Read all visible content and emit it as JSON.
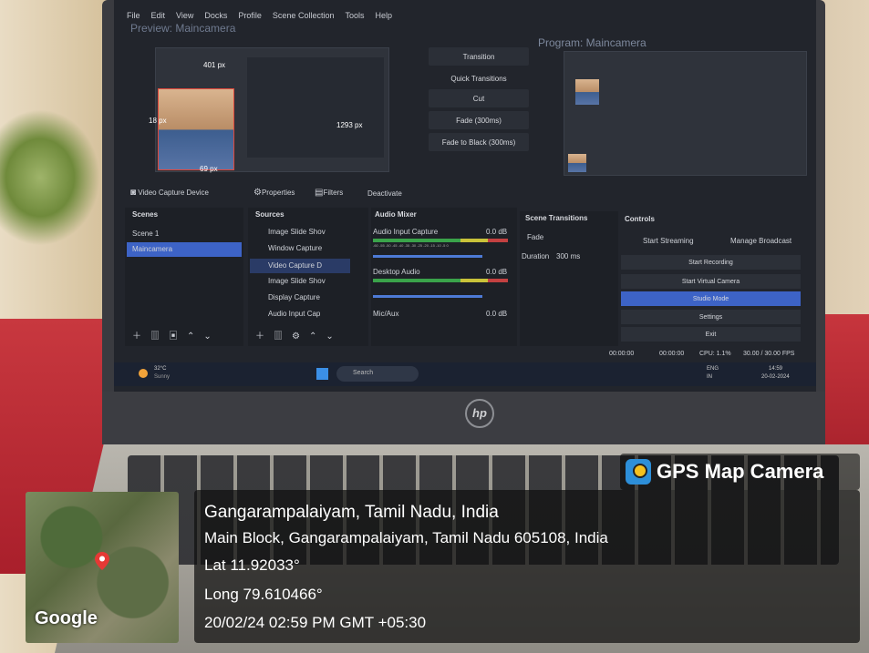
{
  "obs": {
    "menu": [
      "File",
      "Edit",
      "View",
      "Docks",
      "Profile",
      "Scene Collection",
      "Tools",
      "Help"
    ],
    "preview_title": "Preview: Maincamera",
    "program_title": "Program: Maincamera",
    "measurements": {
      "top": "401 px",
      "left": "18 px",
      "right": "1293 px",
      "bottom": "69 px"
    },
    "transition_buttons": [
      "Transition",
      "Quick Transitions",
      "Cut",
      "Fade (300ms)",
      "Fade to Black (300ms)"
    ],
    "source_toolbar": {
      "label": "Video Capture Device",
      "properties": "Properties",
      "filters": "Filters",
      "deactivate": "Deactivate"
    },
    "scenes": {
      "header": "Scenes",
      "items": [
        "Scene 1",
        "Maincamera"
      ],
      "selected": "Maincamera"
    },
    "sources": {
      "header": "Sources",
      "items": [
        "Image Slide Shov",
        "Window Capture",
        "Video Capture D",
        "Image Slide Shov",
        "Display Capture",
        "Audio Input Cap"
      ],
      "selected_index": 2
    },
    "audio_mixer": {
      "header": "Audio Mixer",
      "channels": [
        {
          "name": "Audio Input Capture",
          "level": "0.0 dB"
        },
        {
          "name": "Desktop Audio",
          "level": "0.0 dB"
        },
        {
          "name": "Mic/Aux",
          "level": "0.0 dB"
        }
      ],
      "scale": "-60 -55 -50 -45 -40 -35 -30 -25 -20 -15 -10 -5 0"
    },
    "scene_transitions": {
      "header": "Scene Transitions",
      "type": "Fade",
      "duration_label": "Duration",
      "duration_value": "300 ms"
    },
    "controls": {
      "header": "Controls",
      "start_streaming": "Start Streaming",
      "manage_broadcast": "Manage Broadcast",
      "start_recording": "Start Recording",
      "start_virtual_camera": "Start Virtual Camera",
      "studio_mode": "Studio Mode",
      "settings": "Settings",
      "exit": "Exit"
    },
    "status": {
      "stream_time": "00:00:00",
      "rec_time": "00:00:00",
      "cpu": "CPU: 1.1%",
      "fps": "30.00 / 30.00 FPS"
    }
  },
  "taskbar": {
    "weather_temp": "32°C",
    "weather_desc": "Sunny",
    "search_placeholder": "Search",
    "lang": "ENG",
    "region": "IN",
    "time": "14:59",
    "date": "20-02-2024"
  },
  "laptop_brand": "hp",
  "gps": {
    "badge": "GPS Map Camera",
    "place": "Gangarampalaiyam, Tamil Nadu, India",
    "address": "Main Block, Gangarampalaiyam, Tamil Nadu 605108, India",
    "lat": "Lat 11.92033°",
    "long": "Long 79.610466°",
    "datetime": "20/02/24 02:59 PM GMT +05:30",
    "map_brand": "Google"
  },
  "colors": {
    "obs_bg": "#22252c",
    "selection": "#3d63c6",
    "tablecloth": "#b5262f",
    "gps_badge_icon": "#2d8fd9"
  }
}
